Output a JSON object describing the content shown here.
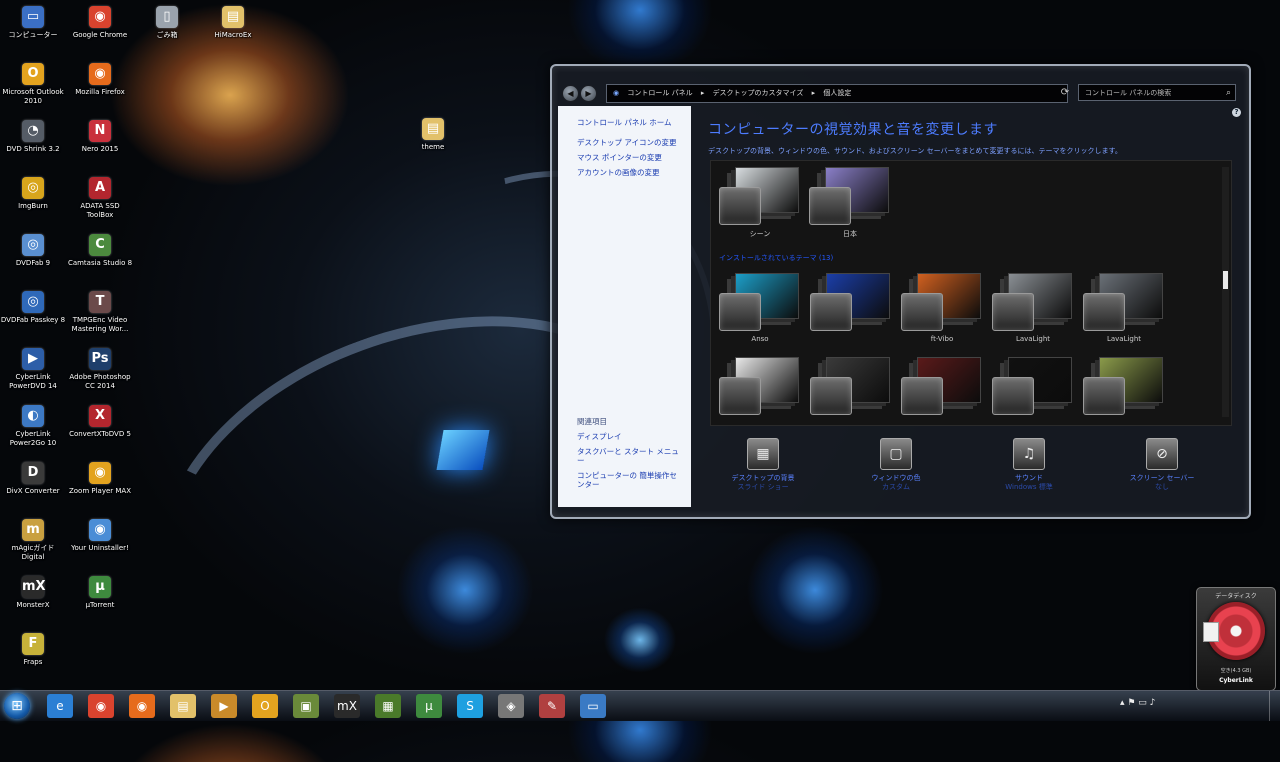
{
  "desktop": {
    "icons": [
      {
        "label": "コンピューター",
        "icon": "computer-icon",
        "glyph": "▭",
        "color": "#3b6fc4"
      },
      {
        "label": "Google Chrome",
        "icon": "chrome-icon",
        "glyph": "◉",
        "color": "#d9432e"
      },
      {
        "label": "ごみ箱",
        "icon": "recycle-bin-icon",
        "glyph": "▯",
        "color": "#9aa3ad"
      },
      {
        "label": "HiMacroEx",
        "icon": "folder-icon",
        "glyph": "▤",
        "color": "#e2c16a"
      },
      {
        "label": "Microsoft Outlook 2010",
        "icon": "outlook-icon",
        "glyph": "O",
        "color": "#e3a31f"
      },
      {
        "label": "Mozilla Firefox",
        "icon": "firefox-icon",
        "glyph": "◉",
        "color": "#e66b1c"
      },
      {
        "label": "DVD Shrink 3.2",
        "icon": "dvd-shrink-icon",
        "glyph": "◔",
        "color": "#555c66"
      },
      {
        "label": "Nero 2015",
        "icon": "nero-icon",
        "glyph": "N",
        "color": "#c9303c"
      },
      {
        "label": "ImgBurn",
        "icon": "imgburn-icon",
        "glyph": "◎",
        "color": "#d8a51c"
      },
      {
        "label": "ADATA SSD ToolBox",
        "icon": "adata-icon",
        "glyph": "A",
        "color": "#b3262e"
      },
      {
        "label": "DVDFab 9",
        "icon": "dvdfab-icon",
        "glyph": "◎",
        "color": "#5a8fd0"
      },
      {
        "label": "Camtasia Studio 8",
        "icon": "camtasia-icon",
        "glyph": "C",
        "color": "#4c8a3e"
      },
      {
        "label": "DVDFab Passkey 8",
        "icon": "passkey-icon",
        "glyph": "◎",
        "color": "#2f69b9"
      },
      {
        "label": "TMPGEnc Video Mastering Wor...",
        "icon": "tmpgenc-icon",
        "glyph": "T",
        "color": "#6b4a4a"
      },
      {
        "label": "CyberLink PowerDVD 14",
        "icon": "powerdvd-icon",
        "glyph": "▶",
        "color": "#2d5ea8"
      },
      {
        "label": "Adobe Photoshop CC 2014",
        "icon": "photoshop-icon",
        "glyph": "Ps",
        "color": "#1f3f6b"
      },
      {
        "label": "CyberLink Power2Go 10",
        "icon": "power2go-icon",
        "glyph": "◐",
        "color": "#3d79c4"
      },
      {
        "label": "ConvertXToDVD 5",
        "icon": "convertx-icon",
        "glyph": "X",
        "color": "#b3262e"
      },
      {
        "label": "DivX Converter",
        "icon": "divx-icon",
        "glyph": "D",
        "color": "#3a3a3a"
      },
      {
        "label": "Zoom Player MAX",
        "icon": "zoomplayer-icon",
        "glyph": "◉",
        "color": "#e3a31f"
      },
      {
        "label": "mAgicガイド Digital",
        "icon": "magic-guide-icon",
        "glyph": "m",
        "color": "#c9a040"
      },
      {
        "label": "Your Uninstaller!",
        "icon": "uninstaller-icon",
        "glyph": "◉",
        "color": "#4a8dd6"
      },
      {
        "label": "MonsterX",
        "icon": "monsterx-icon",
        "glyph": "mX",
        "color": "#2a2a2a"
      },
      {
        "label": "µTorrent",
        "icon": "utorrent-icon",
        "glyph": "µ",
        "color": "#3e8a3e"
      },
      {
        "label": "Fraps",
        "icon": "fraps-icon",
        "glyph": "F",
        "color": "#c7b23a"
      },
      {
        "label": "theme",
        "icon": "folder-icon",
        "glyph": "▤",
        "color": "#e2c16a"
      }
    ]
  },
  "window": {
    "address": {
      "segments": [
        "コントロール パネル",
        "デスクトップのカスタマイズ",
        "個人設定"
      ],
      "separator": "▸"
    },
    "search_placeholder": "コントロール パネルの検索",
    "help": "?",
    "sidebar": {
      "home": "コントロール パネル ホーム",
      "links": [
        "デスクトップ アイコンの変更",
        "マウス ポインターの変更",
        "アカウントの画像の変更"
      ],
      "see_also_header": "関連項目",
      "see_also": [
        "ディスプレイ",
        "タスクバーと スタート メニュー",
        "コンピューターの 簡単操作センター"
      ]
    },
    "title": "コンピューターの視覚効果と音を変更します",
    "subtitle": "デスクトップの背景、ウィンドウの色、サウンド、およびスクリーン セーバーをまとめて変更するには、テーマをクリックします。",
    "gallery": {
      "row1": [
        {
          "label": "シーン",
          "art": "#d8dde0"
        },
        {
          "label": "日本",
          "art": "#8a7fc8"
        }
      ],
      "group_label": "インストールされているテーマ (13)",
      "row2": [
        {
          "label": "Anso",
          "art": "#1c9ec8"
        },
        {
          "label": "",
          "art": "#1b3ea8"
        },
        {
          "label": "ft-Vibo",
          "art": "#d06020"
        },
        {
          "label": "LavaLight",
          "art": "#8a8f94"
        },
        {
          "label": "LavaLight",
          "art": "#6a7077"
        }
      ],
      "row3": [
        {
          "label": "",
          "art": "#e8e8e8"
        },
        {
          "label": "",
          "art": "#3a3a3a"
        },
        {
          "label": "",
          "art": "#5a1a1a"
        },
        {
          "label": "",
          "art": "#111111"
        },
        {
          "label": "",
          "art": "#8a9a4a"
        }
      ]
    },
    "commands": [
      {
        "title": "デスクトップの背景",
        "sub": "スライド ショー",
        "icon": "desktop-background-icon",
        "glyph": "▦"
      },
      {
        "title": "ウィンドウの色",
        "sub": "カスタム",
        "icon": "window-color-icon",
        "glyph": "▢"
      },
      {
        "title": "サウンド",
        "sub": "Windows 標準",
        "icon": "sound-icon",
        "glyph": "♫"
      },
      {
        "title": "スクリーン セーバー",
        "sub": "なし",
        "icon": "screen-saver-icon",
        "glyph": "⊘"
      }
    ]
  },
  "taskbar": {
    "start_glyph": "⊞",
    "apps": [
      {
        "name": "ie",
        "icon": "internet-explorer-icon",
        "glyph": "e",
        "color": "#2b7fd4"
      },
      {
        "name": "chrome",
        "icon": "chrome-icon",
        "glyph": "◉",
        "color": "#d9432e"
      },
      {
        "name": "firefox",
        "icon": "firefox-icon",
        "glyph": "◉",
        "color": "#e66b1c"
      },
      {
        "name": "explorer",
        "icon": "explorer-folder-icon",
        "glyph": "▤",
        "color": "#e2c16a"
      },
      {
        "name": "media",
        "icon": "media-player-icon",
        "glyph": "▶",
        "color": "#c98a2a"
      },
      {
        "name": "outlook",
        "icon": "outlook-icon",
        "glyph": "O",
        "color": "#e3a31f"
      },
      {
        "name": "imageviewer",
        "icon": "image-viewer-icon",
        "glyph": "▣",
        "color": "#6a8a3a"
      },
      {
        "name": "monsterx",
        "icon": "monsterx-icon",
        "glyph": "mX",
        "color": "#2a2a2a"
      },
      {
        "name": "greenapp",
        "icon": "green-app-icon",
        "glyph": "▦",
        "color": "#4a7a2a"
      },
      {
        "name": "utorrent",
        "icon": "utorrent-icon",
        "glyph": "µ",
        "color": "#3e8a3e"
      },
      {
        "name": "skype",
        "icon": "skype-icon",
        "glyph": "S",
        "color": "#1ea0e0"
      },
      {
        "name": "tool",
        "icon": "tool-icon",
        "glyph": "◈",
        "color": "#777777"
      },
      {
        "name": "paint",
        "icon": "paint-icon",
        "glyph": "✎",
        "color": "#b04040"
      },
      {
        "name": "control",
        "icon": "control-panel-icon",
        "glyph": "▭",
        "color": "#3a7ac4"
      }
    ],
    "tray_glyphs": "▴ ⚑ ▭ ♪"
  },
  "gadget": {
    "title": "データディスク",
    "drive": "空き(4.3 GB)",
    "brand": "CyberLink"
  },
  "colors": {
    "link": "#1a3cb0",
    "heading": "#4d7cff",
    "group": "#2458ff"
  }
}
